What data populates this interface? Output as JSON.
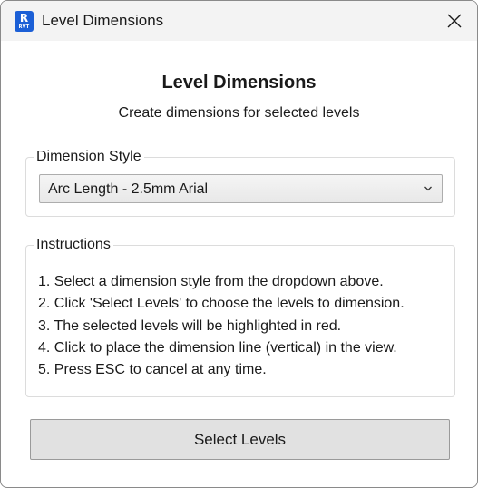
{
  "window": {
    "title": "Level Dimensions",
    "app_icon": {
      "letter": "R",
      "caption": "RVT",
      "color": "#1b5fd6"
    }
  },
  "header": {
    "title": "Level Dimensions",
    "subtitle": "Create dimensions for selected levels"
  },
  "dimension_style": {
    "legend": "Dimension Style",
    "selected": "Arc Length - 2.5mm Arial"
  },
  "instructions": {
    "legend": "Instructions",
    "steps": [
      "1. Select a dimension style from the dropdown above.",
      "2. Click 'Select Levels' to choose the levels to dimension.",
      "3. The selected levels will be highlighted in red.",
      "4. Click to place the dimension line (vertical) in the view.",
      "5. Press ESC to cancel at any time."
    ]
  },
  "actions": {
    "select_levels_label": "Select Levels"
  },
  "icons": {
    "close": "close-icon",
    "dropdown": "chevron-down-icon",
    "app": "revit-app-icon"
  }
}
